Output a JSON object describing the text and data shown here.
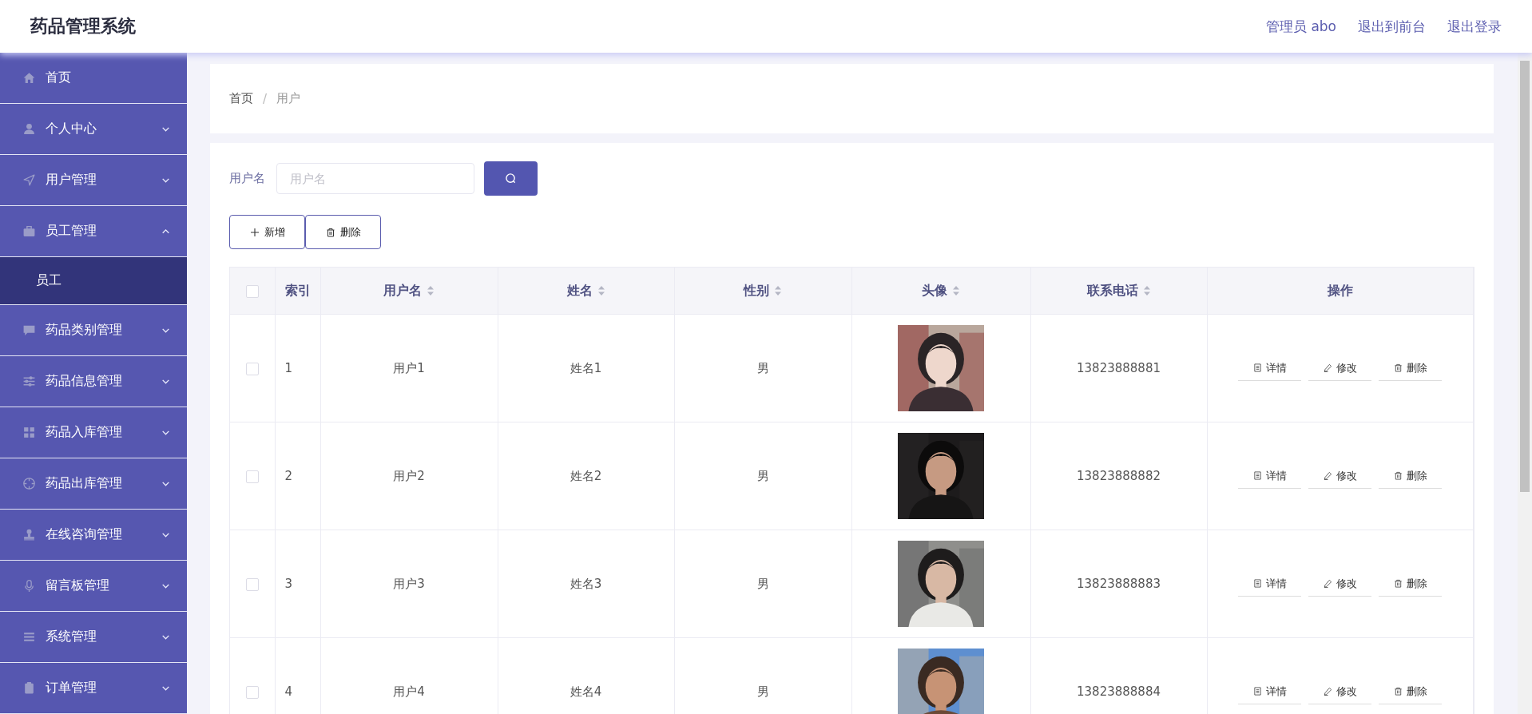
{
  "header": {
    "title": "药品管理系统",
    "links": [
      "管理员 abo",
      "退出到前台",
      "退出登录"
    ]
  },
  "sidebar": {
    "items": [
      {
        "label": "首页",
        "kind": "link"
      },
      {
        "label": "个人中心",
        "kind": "submenu",
        "expanded": false
      },
      {
        "label": "用户管理",
        "kind": "submenu",
        "expanded": false
      },
      {
        "label": "员工管理",
        "kind": "submenu",
        "expanded": true,
        "children": [
          {
            "label": "员工",
            "selected": true
          }
        ]
      },
      {
        "label": "药品类别管理",
        "kind": "submenu",
        "expanded": false
      },
      {
        "label": "药品信息管理",
        "kind": "submenu",
        "expanded": false
      },
      {
        "label": "药品入库管理",
        "kind": "submenu",
        "expanded": false
      },
      {
        "label": "药品出库管理",
        "kind": "submenu",
        "expanded": false
      },
      {
        "label": "在线咨询管理",
        "kind": "submenu",
        "expanded": false
      },
      {
        "label": "留言板管理",
        "kind": "submenu",
        "expanded": false
      },
      {
        "label": "系统管理",
        "kind": "submenu",
        "expanded": false
      },
      {
        "label": "订单管理",
        "kind": "submenu",
        "expanded": false
      }
    ]
  },
  "breadcrumb": {
    "items": [
      "首页",
      "用户"
    ],
    "separator": "/"
  },
  "search": {
    "label": "用户名",
    "placeholder": "用户名"
  },
  "buttons": [
    {
      "label": "新增",
      "kind": "add"
    },
    {
      "label": "删除",
      "kind": "delete"
    }
  ],
  "table": {
    "select_all": {
      "checked": false
    },
    "columns": [
      {
        "label": "索引",
        "sortable": false
      },
      {
        "label": "用户名",
        "sortable": true
      },
      {
        "label": "姓名",
        "sortable": true
      },
      {
        "label": "性别",
        "sortable": true
      },
      {
        "label": "头像",
        "sortable": true
      },
      {
        "label": "联系电话",
        "sortable": true
      },
      {
        "label": "操作",
        "sortable": false
      }
    ],
    "rows": [
      {
        "checked": false,
        "index": "1",
        "username": "用户1",
        "name": "姓名1",
        "gender": "男",
        "avatar": {
          "kind": "picture"
        },
        "phone": "13823888881",
        "actions": [
          "详情",
          "修改",
          "删除"
        ]
      },
      {
        "checked": false,
        "index": "2",
        "username": "用户2",
        "name": "姓名2",
        "gender": "男",
        "avatar": {
          "kind": "picture"
        },
        "phone": "13823888882",
        "actions": [
          "详情",
          "修改",
          "删除"
        ]
      },
      {
        "checked": false,
        "index": "3",
        "username": "用户3",
        "name": "姓名3",
        "gender": "男",
        "avatar": {
          "kind": "picture"
        },
        "phone": "13823888883",
        "actions": [
          "详情",
          "修改",
          "删除"
        ]
      },
      {
        "checked": false,
        "index": "4",
        "username": "用户4",
        "name": "姓名4",
        "gender": "男",
        "avatar": {
          "kind": "picture"
        },
        "phone": "13823888884",
        "actions": [
          "详情",
          "修改",
          "删除"
        ]
      }
    ]
  }
}
